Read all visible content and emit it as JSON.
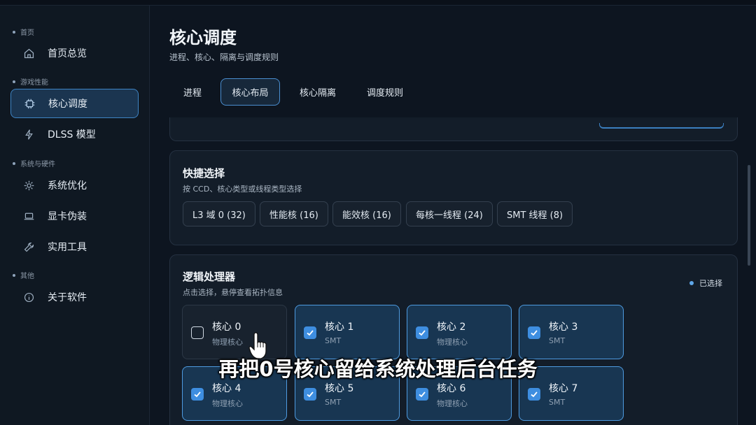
{
  "sidebar": {
    "sections": [
      {
        "label": "首页"
      },
      {
        "label": "游戏性能"
      },
      {
        "label": "系统与硬件"
      },
      {
        "label": "其他"
      }
    ],
    "items": [
      {
        "label": "首页总览",
        "icon": "home-icon"
      },
      {
        "label": "核心调度",
        "icon": "chip-icon",
        "active": true
      },
      {
        "label": "DLSS 模型",
        "icon": "bolt-icon"
      },
      {
        "label": "系统优化",
        "icon": "gear-icon"
      },
      {
        "label": "显卡伪装",
        "icon": "laptop-icon"
      },
      {
        "label": "实用工具",
        "icon": "wrench-icon"
      },
      {
        "label": "关于软件",
        "icon": "info-icon"
      }
    ]
  },
  "header": {
    "title": "核心调度",
    "subtitle": "进程、核心、隔离与调度规则"
  },
  "tabs": [
    {
      "label": "进程"
    },
    {
      "label": "核心布局",
      "active": true
    },
    {
      "label": "核心隔离"
    },
    {
      "label": "调度规则"
    }
  ],
  "quick_select": {
    "title": "快捷选择",
    "subtitle": "按 CCD、核心类型或线程类型选择",
    "chips": [
      {
        "label": "L3 域 0 (32)"
      },
      {
        "label": "性能核 (16)"
      },
      {
        "label": "能效核 (16)"
      },
      {
        "label": "每核一线程 (24)"
      },
      {
        "label": "SMT 线程 (8)"
      }
    ]
  },
  "logical": {
    "title": "逻辑处理器",
    "subtitle": "点击选择，悬停查看拓扑信息",
    "legend": "已选择",
    "cores": [
      {
        "name": "核心 0",
        "type": "物理核心",
        "selected": false
      },
      {
        "name": "核心 1",
        "type": "SMT",
        "selected": true
      },
      {
        "name": "核心 2",
        "type": "物理核心",
        "selected": true
      },
      {
        "name": "核心 3",
        "type": "SMT",
        "selected": true
      },
      {
        "name": "核心 4",
        "type": "物理核心",
        "selected": true
      },
      {
        "name": "核心 5",
        "type": "SMT",
        "selected": true
      },
      {
        "name": "核心 6",
        "type": "物理核心",
        "selected": true
      },
      {
        "name": "核心 7",
        "type": "SMT",
        "selected": true
      }
    ]
  },
  "caption": "再把0号核心留给系统处理后台任务",
  "colors": {
    "accent": "#3e8ee0",
    "background": "#0d1520",
    "panel": "#131d29"
  }
}
